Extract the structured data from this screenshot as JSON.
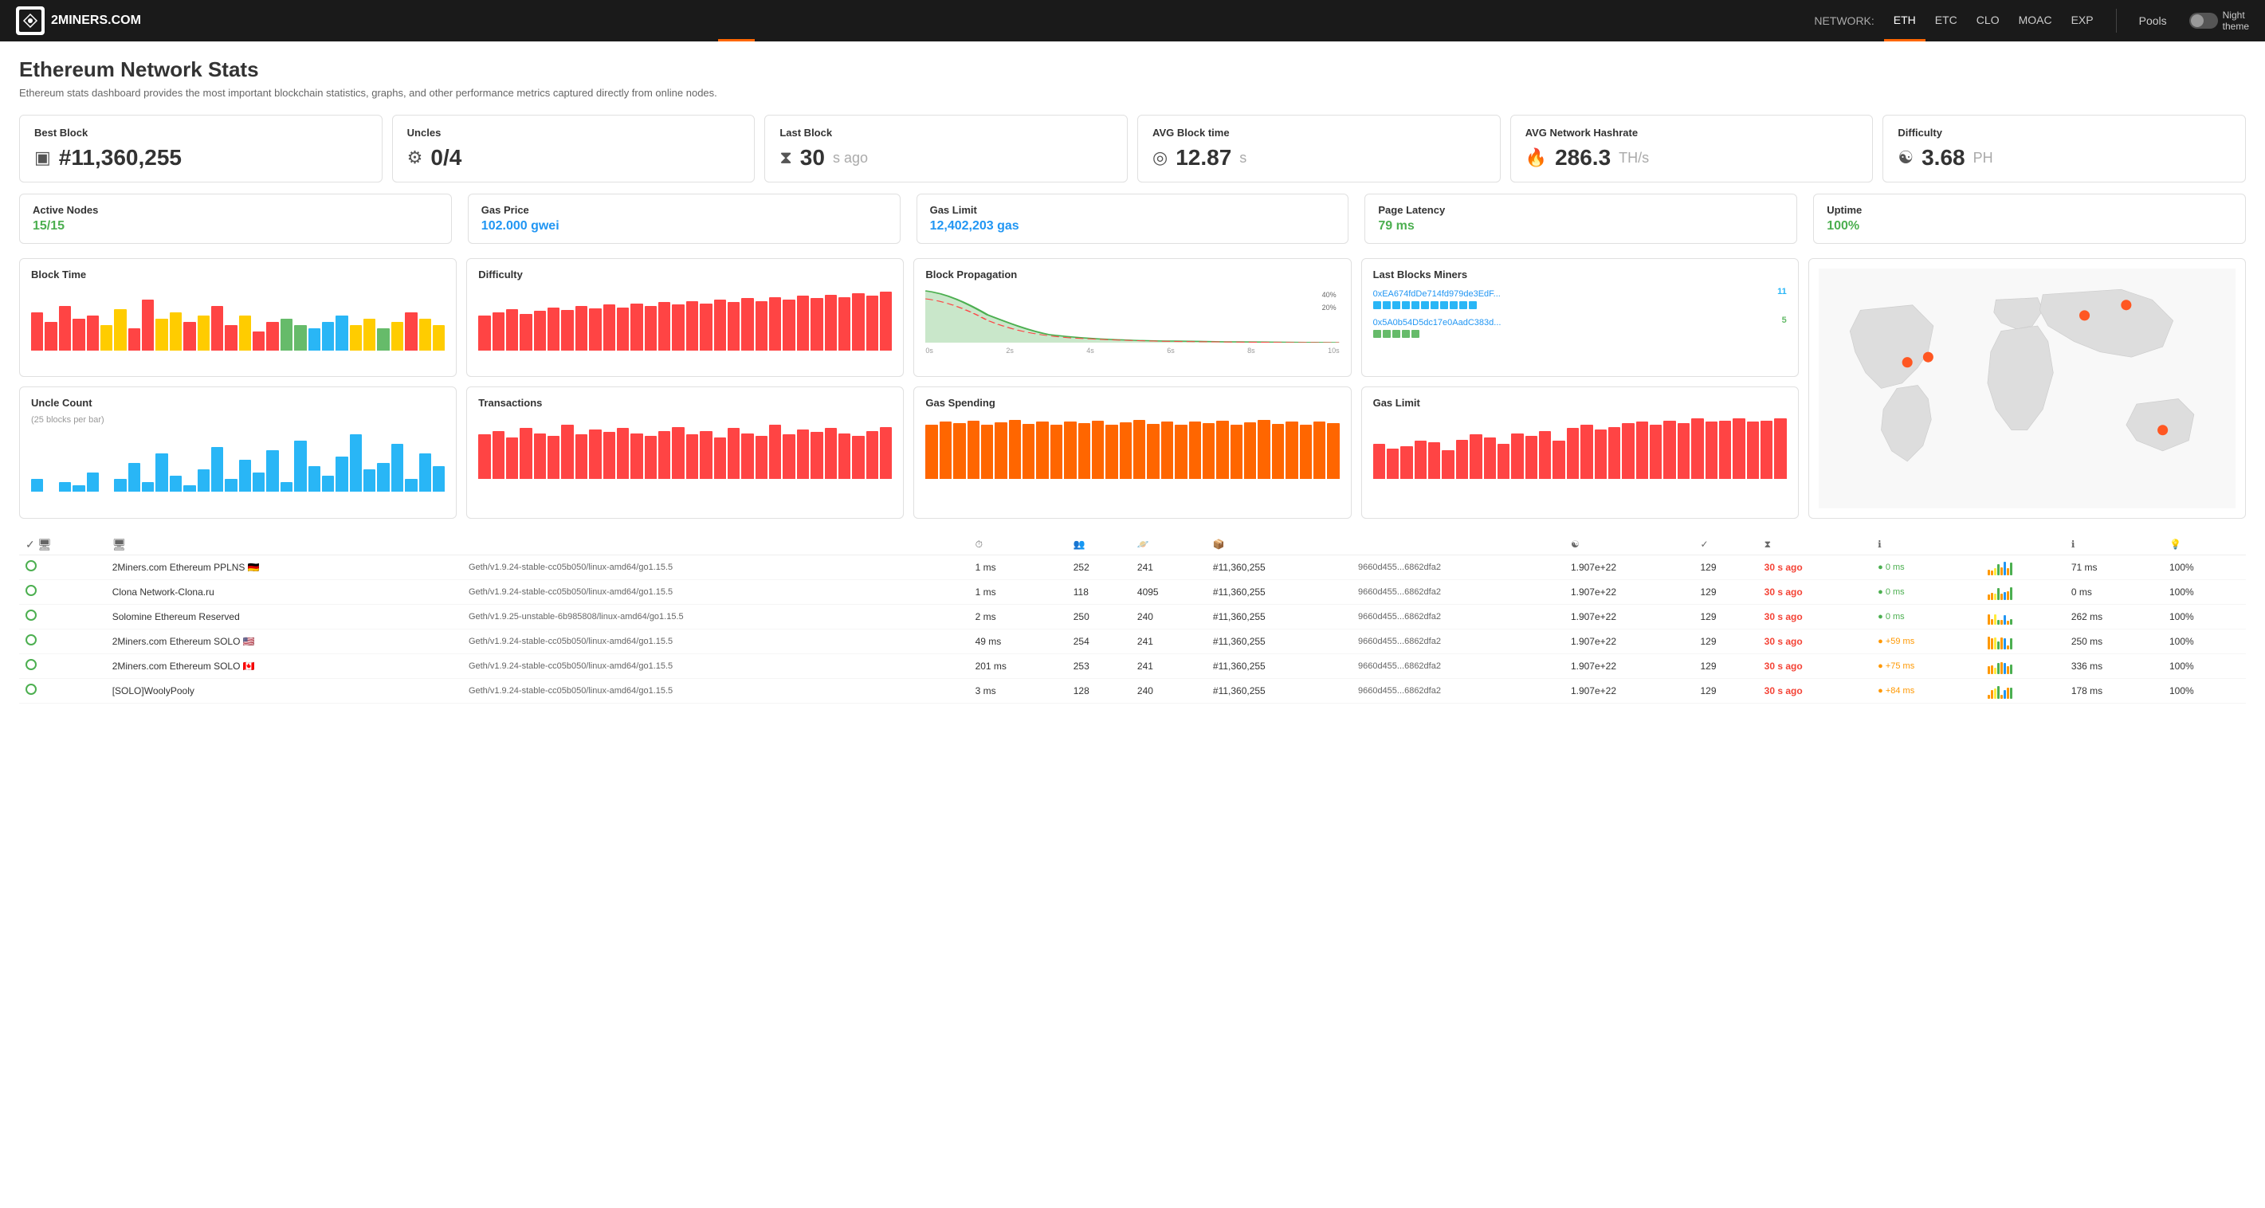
{
  "header": {
    "logo_text": "2MINERS.COM",
    "nav_label": "NETWORK:",
    "nav_items": [
      "ETH",
      "ETC",
      "CLO",
      "MOAC",
      "EXP"
    ],
    "active_nav": "ETH",
    "pools_label": "Pools",
    "night_theme_label": "Night\ntheme"
  },
  "page": {
    "title": "Ethereum Network Stats",
    "subtitle": "Ethereum stats dashboard provides the most important blockchain statistics, graphs, and other performance metrics captured directly from online nodes."
  },
  "stat_cards": [
    {
      "label": "Best Block",
      "icon": "▣",
      "value": "#11,360,255",
      "unit": ""
    },
    {
      "label": "Uncles",
      "icon": "⚙",
      "value": "0/4",
      "unit": ""
    },
    {
      "label": "Last Block",
      "icon": "⧗",
      "value": "30",
      "unit": "s ago"
    },
    {
      "label": "AVG Block time",
      "icon": "◎",
      "value": "12.87",
      "unit": "s"
    },
    {
      "label": "AVG Network Hashrate",
      "icon": "🔥",
      "value": "286.3",
      "unit": "TH/s"
    },
    {
      "label": "Difficulty",
      "icon": "☯",
      "value": "3.68",
      "unit": "PH"
    }
  ],
  "stat_cards_2": [
    {
      "label": "Active Nodes",
      "value": "15/15",
      "color": "green"
    },
    {
      "label": "Gas Price",
      "value": "102.000 gwei",
      "color": "blue"
    },
    {
      "label": "Gas Limit",
      "value": "12,402,203 gas",
      "color": "blue"
    },
    {
      "label": "Page Latency",
      "value": "79 ms",
      "color": "green"
    },
    {
      "label": "Uptime",
      "value": "100%",
      "color": "green"
    }
  ],
  "chart_titles": {
    "block_time": "Block Time",
    "difficulty": "Difficulty",
    "block_propagation": "Block Propagation",
    "last_blocks_miners": "Last Blocks Miners",
    "uncle_count": "Uncle Count",
    "uncle_count_sub": "(25 blocks per bar)",
    "transactions": "Transactions",
    "gas_spending": "Gas Spending",
    "gas_limit": "Gas Limit"
  },
  "last_blocks_miners": [
    {
      "addr": "0xEA674fdDe714fd979de3EdF...",
      "count": 11,
      "color": "blue"
    },
    {
      "addr": "0x5A0b54D5dc17e0AadC383d...",
      "count": 5,
      "color": "green"
    }
  ],
  "prop_labels": [
    "0s",
    "2s",
    "4s",
    "6s",
    "8s",
    "10s"
  ],
  "prop_right_labels": [
    "40%",
    "20%"
  ],
  "nodes": [
    {
      "name": "2Miners.com Ethereum PPLNS",
      "flag": "🇩🇪",
      "client": "Geth/v1.9.24-stable-cc05b050/linux-amd64/go1.15.5",
      "latency": "1 ms",
      "peers": "252",
      "pending": "241",
      "block": "#11,360,255",
      "blockhash": "9660d455...6862dfa2",
      "difficulty": "1.907e+22",
      "uncles": "129",
      "last_seen": "30 s ago",
      "propagation": "● 0 ms",
      "prop_color": "green",
      "latency_ms": "71 ms",
      "uptime": "100%"
    },
    {
      "name": "Clona Network-Clona.ru",
      "flag": "",
      "client": "Geth/v1.9.24-stable-cc05b050/linux-amd64/go1.15.5",
      "latency": "1 ms",
      "peers": "118",
      "pending": "4095",
      "block": "#11,360,255",
      "blockhash": "9660d455...6862dfa2",
      "difficulty": "1.907e+22",
      "uncles": "129",
      "last_seen": "30 s ago",
      "propagation": "● 0 ms",
      "prop_color": "green",
      "latency_ms": "0 ms",
      "uptime": "100%"
    },
    {
      "name": "Solomine Ethereum Reserved",
      "flag": "",
      "client": "Geth/v1.9.25-unstable-6b985808/linux-amd64/go1.15.5",
      "latency": "2 ms",
      "peers": "250",
      "pending": "240",
      "block": "#11,360,255",
      "blockhash": "9660d455...6862dfa2",
      "difficulty": "1.907e+22",
      "uncles": "129",
      "last_seen": "30 s ago",
      "propagation": "● 0 ms",
      "prop_color": "green",
      "latency_ms": "262 ms",
      "uptime": "100%"
    },
    {
      "name": "2Miners.com Ethereum SOLO",
      "flag": "🇺🇸",
      "client": "Geth/v1.9.24-stable-cc05b050/linux-amd64/go1.15.5",
      "latency": "49 ms",
      "peers": "254",
      "pending": "241",
      "block": "#11,360,255",
      "blockhash": "9660d455...6862dfa2",
      "difficulty": "1.907e+22",
      "uncles": "129",
      "last_seen": "30 s ago",
      "propagation": "● +59 ms",
      "prop_color": "orange",
      "latency_ms": "250 ms",
      "uptime": "100%"
    },
    {
      "name": "2Miners.com Ethereum SOLO",
      "flag": "🇨🇦",
      "client": "Geth/v1.9.24-stable-cc05b050/linux-amd64/go1.15.5",
      "latency": "201 ms",
      "peers": "253",
      "pending": "241",
      "block": "#11,360,255",
      "blockhash": "9660d455...6862dfa2",
      "difficulty": "1.907e+22",
      "uncles": "129",
      "last_seen": "30 s ago",
      "propagation": "● +75 ms",
      "prop_color": "orange",
      "latency_ms": "336 ms",
      "uptime": "100%"
    },
    {
      "name": "[SOLO]WoolyPooly",
      "flag": "",
      "client": "Geth/v1.9.24-stable-cc05b050/linux-amd64/go1.15.5",
      "latency": "3 ms",
      "peers": "128",
      "pending": "240",
      "block": "#11,360,255",
      "blockhash": "9660d455...6862dfa2",
      "difficulty": "1.907e+22",
      "uncles": "129",
      "last_seen": "30 s ago",
      "propagation": "● +84 ms",
      "prop_color": "orange",
      "latency_ms": "178 ms",
      "uptime": "100%"
    }
  ],
  "table_headers": {
    "status": "",
    "node": "",
    "client": "",
    "latency": "⏱",
    "peers": "👥",
    "pending": "🪐",
    "block": "📦",
    "blockhash": "☯",
    "difficulty": "✓",
    "uncles": "⧗",
    "last_seen": "ℹ",
    "propagation": "",
    "latency_ms": "ℹ",
    "uptime": "💡"
  }
}
